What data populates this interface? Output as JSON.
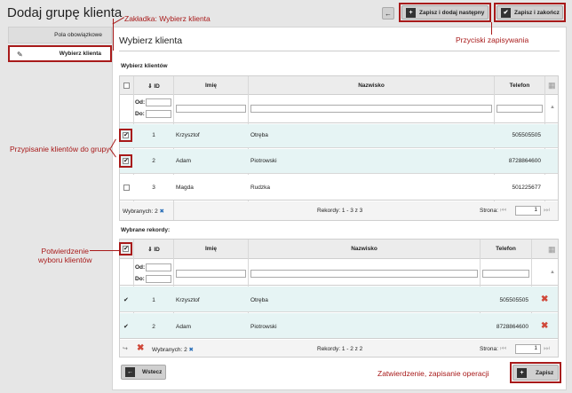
{
  "page": {
    "title": "Dodaj grupę klienta"
  },
  "sidebar": {
    "items": [
      {
        "label": "Pola obowiązkowe"
      },
      {
        "label": "Wybierz klienta"
      }
    ]
  },
  "toolbar": {
    "back_icon": "←",
    "save_next_label": "Zapisz i dodaj następny",
    "save_close_label": "Zapisz i zakończ"
  },
  "panel": {
    "title": "Wybierz klienta"
  },
  "clients": {
    "section_label": "Wybierz klientów",
    "columns": {
      "id": "⇓ ID",
      "imie": "Imię",
      "nazwisko": "Nazwisko",
      "telefon": "Telefon"
    },
    "filter": {
      "od": "Od:",
      "do": "Do:"
    },
    "rows": [
      {
        "id": "1",
        "imie": "Krzysztof",
        "nazwisko": "Otręba",
        "telefon": "505505505",
        "checked": true
      },
      {
        "id": "2",
        "imie": "Adam",
        "nazwisko": "Piotrowski",
        "telefon": "8728864600",
        "checked": true
      },
      {
        "id": "3",
        "imie": "Magda",
        "nazwisko": "Rudzka",
        "telefon": "501225677",
        "checked": false
      }
    ],
    "footer": {
      "selected": "Wybranych: 2",
      "records": "Rekordy: 1 - 3 z 3",
      "page_label": "Strona:",
      "page_value": "1"
    }
  },
  "selected": {
    "section_label": "Wybrane rekordy:",
    "columns": {
      "id": "⇓ ID",
      "imie": "Imię",
      "nazwisko": "Nazwisko",
      "telefon": "Telefon"
    },
    "filter": {
      "od": "Od:",
      "do": "Do:"
    },
    "rows": [
      {
        "id": "1",
        "imie": "Krzysztof",
        "nazwisko": "Otręba",
        "telefon": "505505505"
      },
      {
        "id": "2",
        "imie": "Adam",
        "nazwisko": "Piotrowski",
        "telefon": "8728864600"
      }
    ],
    "footer": {
      "selected": "Wybranych: 2",
      "records": "Rekordy: 1 - 2 z 2",
      "page_label": "Strona:",
      "page_value": "1"
    }
  },
  "buttons": {
    "back": "Wstecz",
    "save": "Zapisz"
  },
  "annotations": {
    "tab": "Zakładka: Wybierz klienta",
    "save_buttons": "Przyciski zapisywania",
    "assign": "Przypisanie klientów do grupy",
    "confirm_1": "Potwierdzenie",
    "confirm_2": "wyboru klientów",
    "approve": "Zatwierdzenie, zapisanie operacji"
  },
  "colors": {
    "accent": "#a81a1a",
    "row_alt": "#e6f4f4",
    "delete": "#d0483a"
  }
}
